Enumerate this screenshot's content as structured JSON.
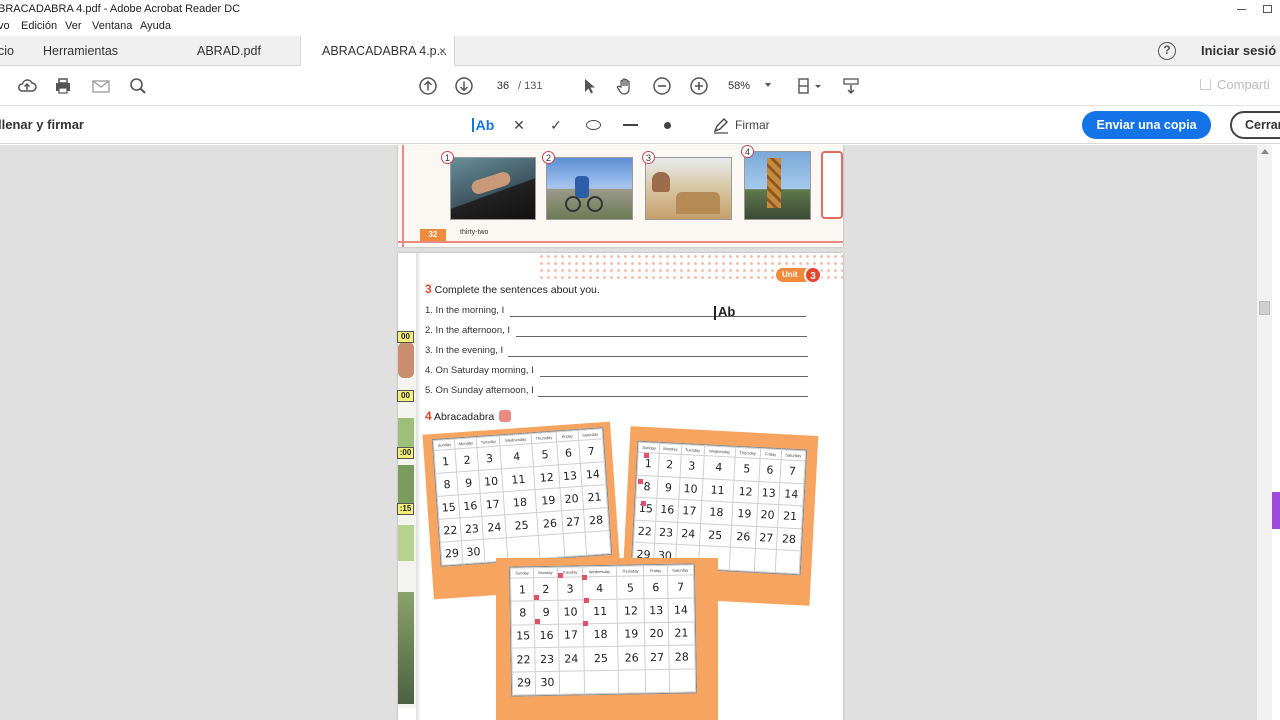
{
  "window": {
    "title": "BRACADABRA 4.pdf - Adobe Acrobat Reader DC"
  },
  "menu": {
    "items": [
      "vo",
      "Edición",
      "Ver",
      "Ventana",
      "Ayuda"
    ]
  },
  "tabs": [
    {
      "label": "cio"
    },
    {
      "label": "Herramientas"
    },
    {
      "label": "ABRAD.pdf"
    },
    {
      "label": "ABRACADABRA 4.p...",
      "close": "×"
    }
  ],
  "header": {
    "signin": "Iniciar sesió",
    "help": "?"
  },
  "toolbar": {
    "current_page": "36",
    "total_pages": "/ 131",
    "zoom": "58%",
    "share": "Comparti"
  },
  "fillsign": {
    "label": "llenar y firmar",
    "text_tool": "Ab",
    "cross_tool": "✕",
    "check_tool": "✓",
    "sign_label": "Firmar",
    "send_button": "Enviar una copia",
    "close_button": "Cerrar"
  },
  "doc": {
    "top_page": {
      "photo_numbers": [
        "1",
        "2",
        "3",
        "4"
      ],
      "page_number": "32",
      "page_word": "thirty-two"
    },
    "main_page": {
      "unit_label": "Unit",
      "unit_number": "3",
      "ex3_number": "3",
      "ex3_title": "Complete the sentences about you.",
      "lines": [
        "1. In the morning, I",
        "2. In the afternoon, I",
        "3. In the evening, I",
        "4. On Saturday morning, I",
        "5. On Sunday afternoon, I"
      ],
      "ex4_number": "4",
      "ex4_title": "Abracadabra",
      "weekdays": [
        "Sunday",
        "Monday",
        "Tuesday",
        "Wednesday",
        "Thursday",
        "Friday",
        "Saturday"
      ],
      "calendar_rows": [
        [
          "1",
          "2",
          "3",
          "4",
          "5",
          "6",
          "7"
        ],
        [
          "8",
          "9",
          "10",
          "11",
          "12",
          "13",
          "14"
        ],
        [
          "15",
          "16",
          "17",
          "18",
          "19",
          "20",
          "21"
        ],
        [
          "22",
          "23",
          "24",
          "25",
          "26",
          "27",
          "28"
        ],
        [
          "29",
          "30",
          "",
          "",
          "",
          "",
          ""
        ]
      ],
      "side_tags": [
        "00",
        "00",
        ":00",
        ":15"
      ]
    },
    "cursor_label": "Ab"
  },
  "colors": {
    "accent": "#1473e6",
    "orange": "#f08a3c",
    "red": "#e2452b",
    "purple": "#9d4bd8"
  }
}
